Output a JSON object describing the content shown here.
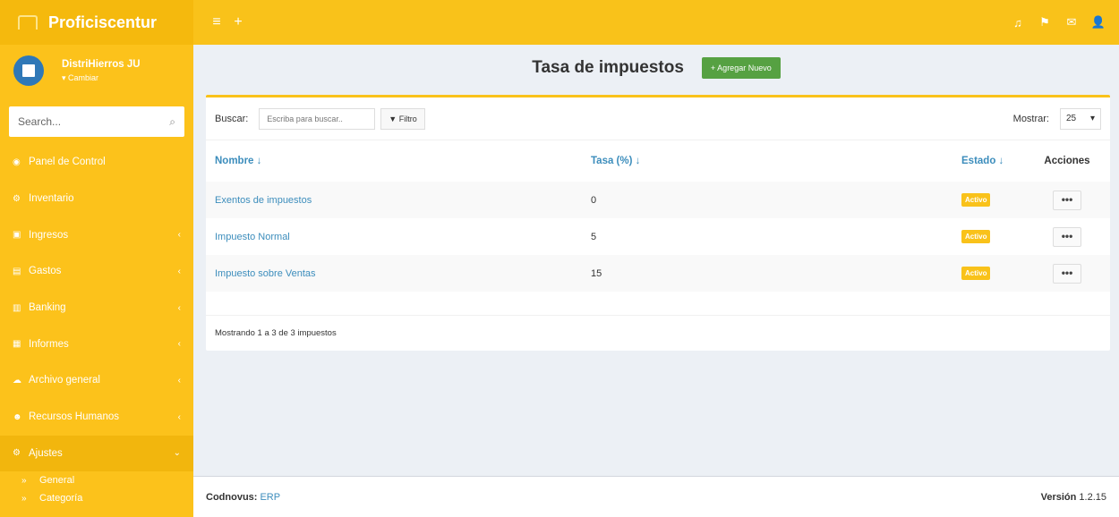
{
  "brand": {
    "name": "Proficiscentur"
  },
  "topbar": {
    "left_icons": [
      "≡",
      "+"
    ],
    "right_icons": [
      "♫",
      "⚑",
      "✉",
      "👤"
    ]
  },
  "user": {
    "name": "DistriHierros JU",
    "change_label": "▾ Cambiar"
  },
  "sidebar_search": {
    "placeholder": "Search...",
    "icon": "⌕"
  },
  "menu": [
    {
      "label": "Panel de Control",
      "icon": "◉",
      "caret": ""
    },
    {
      "label": "Inventario",
      "icon": "⚙",
      "caret": ""
    },
    {
      "label": "Ingresos",
      "icon": "▣",
      "caret": "‹"
    },
    {
      "label": "Gastos",
      "icon": "▤",
      "caret": "‹"
    },
    {
      "label": "Banking",
      "icon": "▥",
      "caret": "‹"
    },
    {
      "label": "Informes",
      "icon": "▦",
      "caret": "‹"
    },
    {
      "label": "Archivo general",
      "icon": "☁",
      "caret": "‹"
    },
    {
      "label": "Recursos Humanos",
      "icon": "☻",
      "caret": "‹"
    },
    {
      "label": "Ajustes",
      "icon": "⚙",
      "caret": "⌄"
    }
  ],
  "submenu": [
    {
      "label": "General",
      "arrow": "»"
    },
    {
      "label": "Categoría",
      "arrow": "»"
    }
  ],
  "header": {
    "title": "Tasa de impuestos",
    "add_button": "+ Agregar Nuevo"
  },
  "toolbar": {
    "search_label": "Buscar:",
    "search_placeholder": "Escriba para buscar..",
    "filter_button": "▼ Filtro",
    "show_label": "Mostrar:",
    "show_value": "25",
    "show_caret": "▾"
  },
  "table": {
    "columns": {
      "name": "Nombre",
      "name_sort": "↓",
      "rate": "Tasa (%)",
      "rate_sort": "↓",
      "status": "Estado",
      "status_sort": "↓",
      "actions": "Acciones"
    },
    "rows": [
      {
        "name": "Exentos de impuestos",
        "rate": "0",
        "status": "Activo",
        "actions": "•••"
      },
      {
        "name": "Impuesto Normal",
        "rate": "5",
        "status": "Activo",
        "actions": "•••"
      },
      {
        "name": "Impuesto sobre Ventas",
        "rate": "15",
        "status": "Activo",
        "actions": "•••"
      }
    ]
  },
  "box_footer": {
    "summary": "Mostrando 1 a 3 de 3 impuestos"
  },
  "footer": {
    "company_label": "Codnovus:",
    "company_link": "ERP",
    "version_label": "Versión",
    "version_value": "1.2.15"
  }
}
